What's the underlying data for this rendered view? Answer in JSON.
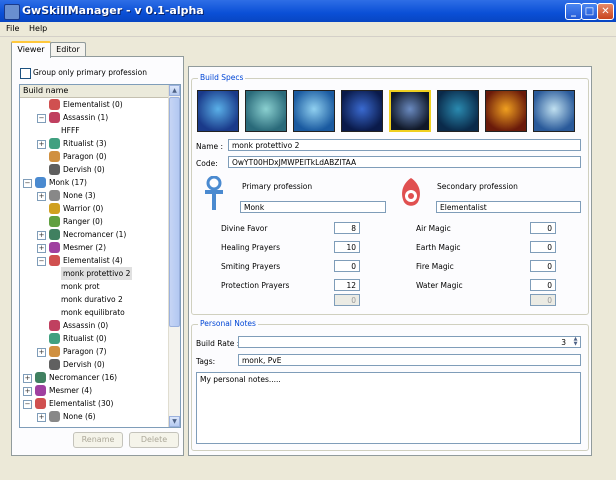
{
  "window": {
    "title": "GwSkillManager - v 0.1-alpha",
    "minimize": "_",
    "maximize": "□",
    "close": "✕"
  },
  "menu": {
    "file": "File",
    "help": "Help"
  },
  "tabs": {
    "viewer": "Viewer",
    "editor": "Editor"
  },
  "left": {
    "group_checkbox_label": "Group only primary profession",
    "tree_header": "Build name",
    "rename": "Rename",
    "delete": "Delete"
  },
  "tree": [
    {
      "text": "Elementalist (0)",
      "indent": 2,
      "exp": "",
      "icon": "elementalist-icon",
      "color": "#d05050"
    },
    {
      "text": "Assassin (1)",
      "indent": 2,
      "exp": "−",
      "icon": "assassin-icon",
      "color": "#c04060"
    },
    {
      "text": "HFFF",
      "indent": 3,
      "exp": "",
      "icon": "",
      "color": ""
    },
    {
      "text": "Ritualist (3)",
      "indent": 2,
      "exp": "+",
      "icon": "ritualist-icon",
      "color": "#40a080"
    },
    {
      "text": "Paragon (0)",
      "indent": 2,
      "exp": "",
      "icon": "paragon-icon",
      "color": "#d09040"
    },
    {
      "text": "Dervish (0)",
      "indent": 2,
      "exp": "",
      "icon": "dervish-icon",
      "color": "#606060"
    },
    {
      "text": "Monk (17)",
      "indent": 1,
      "exp": "−",
      "icon": "monk-icon",
      "color": "#4a8ad0"
    },
    {
      "text": "None (3)",
      "indent": 2,
      "exp": "+",
      "icon": "none-icon",
      "color": "#888888"
    },
    {
      "text": "Warrior (0)",
      "indent": 2,
      "exp": "",
      "icon": "warrior-icon",
      "color": "#d0a020"
    },
    {
      "text": "Ranger (0)",
      "indent": 2,
      "exp": "",
      "icon": "ranger-icon",
      "color": "#60a040"
    },
    {
      "text": "Necromancer (1)",
      "indent": 2,
      "exp": "+",
      "icon": "necromancer-icon",
      "color": "#408060"
    },
    {
      "text": "Mesmer (2)",
      "indent": 2,
      "exp": "+",
      "icon": "mesmer-icon",
      "color": "#a040a0"
    },
    {
      "text": "Elementalist (4)",
      "indent": 2,
      "exp": "−",
      "icon": "elementalist-icon",
      "color": "#d05050"
    },
    {
      "text": "monk protettivo 2",
      "indent": 3,
      "exp": "",
      "icon": "",
      "color": "",
      "selected": true
    },
    {
      "text": "monk prot",
      "indent": 3,
      "exp": "",
      "icon": "",
      "color": ""
    },
    {
      "text": "monk durativo 2",
      "indent": 3,
      "exp": "",
      "icon": "",
      "color": ""
    },
    {
      "text": "monk equilibrato",
      "indent": 3,
      "exp": "",
      "icon": "",
      "color": ""
    },
    {
      "text": "Assassin (0)",
      "indent": 2,
      "exp": "",
      "icon": "assassin-icon",
      "color": "#c04060"
    },
    {
      "text": "Ritualist (0)",
      "indent": 2,
      "exp": "",
      "icon": "ritualist-icon",
      "color": "#40a080"
    },
    {
      "text": "Paragon (7)",
      "indent": 2,
      "exp": "+",
      "icon": "paragon-icon",
      "color": "#d09040"
    },
    {
      "text": "Dervish (0)",
      "indent": 2,
      "exp": "",
      "icon": "dervish-icon",
      "color": "#606060"
    },
    {
      "text": "Necromancer (16)",
      "indent": 1,
      "exp": "+",
      "icon": "necromancer-icon",
      "color": "#408060"
    },
    {
      "text": "Mesmer (4)",
      "indent": 1,
      "exp": "+",
      "icon": "mesmer-icon",
      "color": "#a040a0"
    },
    {
      "text": "Elementalist (30)",
      "indent": 1,
      "exp": "−",
      "icon": "elementalist-icon",
      "color": "#d05050"
    },
    {
      "text": "None (6)",
      "indent": 2,
      "exp": "+",
      "icon": "none-icon",
      "color": "#888888"
    }
  ],
  "build_specs": {
    "legend": "Build Specs",
    "name_label": "Name :",
    "name_value": "monk protettivo 2",
    "code_label": "Code:",
    "code_value": "OwYT00HDxJMWPEITkLdABZITAA",
    "skills": [
      {
        "icon": "skill-1-icon",
        "c1": "#1a3a8a",
        "c2": "#5ab0e8"
      },
      {
        "icon": "skill-2-icon",
        "c1": "#2a6a7a",
        "c2": "#8ad0d0"
      },
      {
        "icon": "skill-3-icon",
        "c1": "#1a5aa0",
        "c2": "#90d0f0"
      },
      {
        "icon": "skill-4-icon",
        "c1": "#0a1a4a",
        "c2": "#3a6ad0"
      },
      {
        "icon": "skill-5-icon",
        "c1": "#101828",
        "c2": "#6a8ac0",
        "selected": true
      },
      {
        "icon": "skill-6-icon",
        "c1": "#0a2a4a",
        "c2": "#2a8ab0"
      },
      {
        "icon": "skill-7-icon",
        "c1": "#6a1a0a",
        "c2": "#f0a020"
      },
      {
        "icon": "skill-8-icon",
        "c1": "#2a5a9a",
        "c2": "#c0e0f0"
      }
    ],
    "primary_label": "Primary profession",
    "primary_value": "Monk",
    "secondary_label": "Secondary profession",
    "secondary_value": "Elementalist",
    "primary_attrs": [
      {
        "label": "Divine Favor",
        "value": "8"
      },
      {
        "label": "Healing Prayers",
        "value": "10"
      },
      {
        "label": "Smiting Prayers",
        "value": "0"
      },
      {
        "label": "Protection Prayers",
        "value": "12"
      }
    ],
    "primary_extra": "0",
    "secondary_attrs": [
      {
        "label": "Air Magic",
        "value": "0"
      },
      {
        "label": "Earth Magic",
        "value": "0"
      },
      {
        "label": "Fire Magic",
        "value": "0"
      },
      {
        "label": "Water Magic",
        "value": "0"
      }
    ],
    "secondary_extra": "0"
  },
  "notes": {
    "legend": "Personal Notes",
    "rate_label": "Build Rate :",
    "rate_value": "3",
    "tags_label": "Tags:",
    "tags_value": "monk, PvE",
    "notes_text": "My personal notes....."
  }
}
